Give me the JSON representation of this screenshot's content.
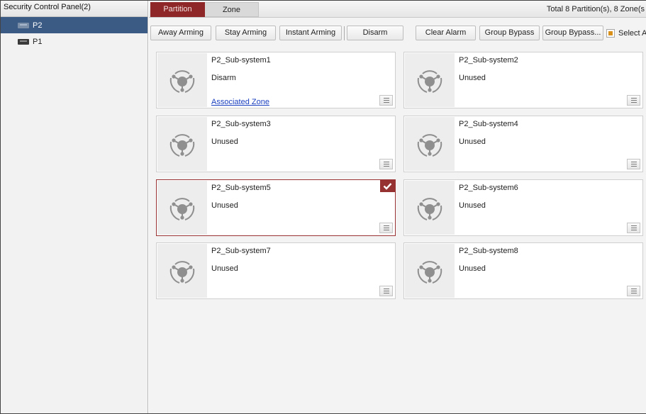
{
  "sidebar": {
    "title": "Security Control Panel(2)",
    "items": [
      {
        "label": "P2",
        "selected": true,
        "icon": "device-icon"
      },
      {
        "label": "P1",
        "selected": false,
        "icon": "device-icon"
      }
    ]
  },
  "tabs": [
    {
      "label": "Partition",
      "active": true
    },
    {
      "label": "Zone",
      "active": false
    }
  ],
  "summary": "Total 8 Partition(s), 8 Zone(s",
  "toolbar": {
    "away_arming": "Away Arming",
    "stay_arming": "Stay Arming",
    "instant_arming": "Instant Arming",
    "disarm": "Disarm",
    "clear_alarm": "Clear Alarm",
    "group_bypass": "Group Bypass",
    "group_bypass_more": "Group Bypass...",
    "select_all": "Select A"
  },
  "colors": {
    "accent": "#8e2727",
    "selected_tree": "#3b5b85",
    "link": "#1a3fbf"
  },
  "partitions": [
    {
      "name": "P2_Sub-system1",
      "status": "Disarm",
      "link": "Associated Zone",
      "selected": false
    },
    {
      "name": "P2_Sub-system2",
      "status": "Unused",
      "link": "",
      "selected": false
    },
    {
      "name": "P2_Sub-system3",
      "status": "Unused",
      "link": "",
      "selected": false
    },
    {
      "name": "P2_Sub-system4",
      "status": "Unused",
      "link": "",
      "selected": false
    },
    {
      "name": "P2_Sub-system5",
      "status": "Unused",
      "link": "",
      "selected": true
    },
    {
      "name": "P2_Sub-system6",
      "status": "Unused",
      "link": "",
      "selected": false
    },
    {
      "name": "P2_Sub-system7",
      "status": "Unused",
      "link": "",
      "selected": false
    },
    {
      "name": "P2_Sub-system8",
      "status": "Unused",
      "link": "",
      "selected": false
    }
  ]
}
